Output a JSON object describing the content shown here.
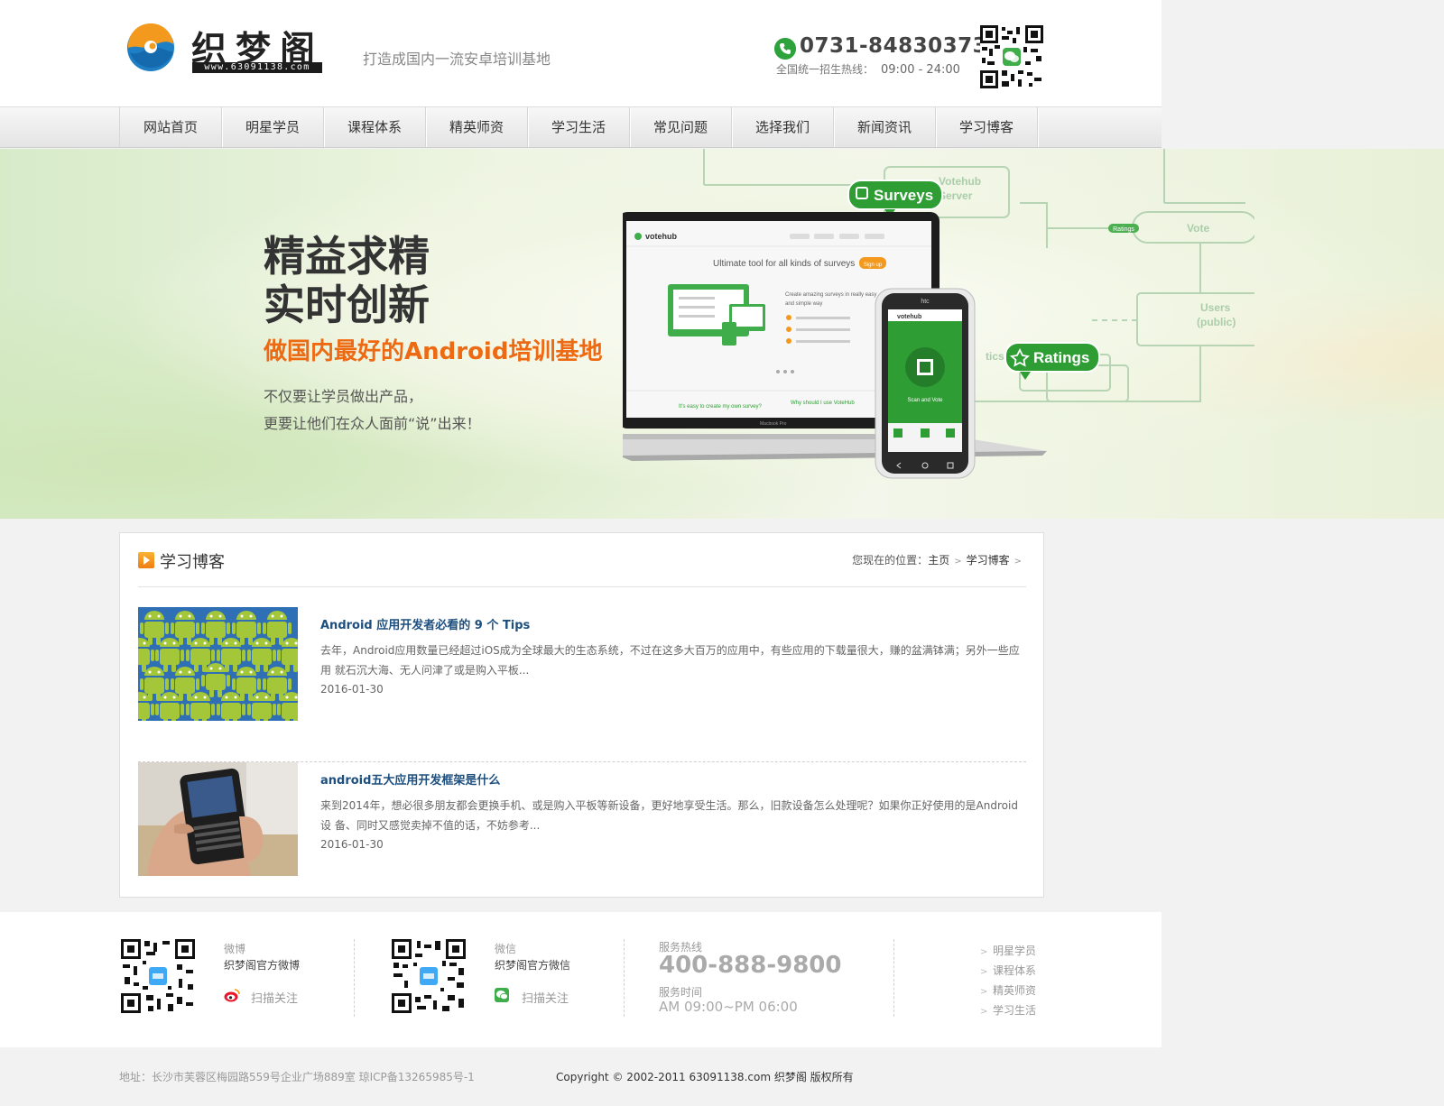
{
  "header": {
    "logo_name": "织梦阁",
    "logo_url": "www.63091138.com",
    "slogan": "打造成国内一流安卓培训基地",
    "phone": "0731-84830373",
    "hotline_label": "全国统一招生热线：",
    "hotline_hours": "09:00 - 24:00"
  },
  "nav": {
    "items": [
      "网站首页",
      "明星学员",
      "课程体系",
      "精英师资",
      "学习生活",
      "常见问题",
      "选择我们",
      "新闻资讯",
      "学习博客"
    ]
  },
  "banner": {
    "headline_1": "精益求精",
    "headline_2": "实时创新",
    "subheadline": "做国内最好的Android培训基地",
    "text_1": "不仅要让学员做出产品，",
    "text_2": "更要让他们在众人面前“说”出来！",
    "art": {
      "surveys_label": "Surveys",
      "ratings_label": "Ratings",
      "ratings_small": "Ratings",
      "vote_label": "Vote",
      "users_label": "Users",
      "users_sub": "(public)",
      "server_label": "Votehub",
      "server_sub": "Server",
      "stats_label": "tics",
      "laptop_brand": "votehub",
      "laptop_tagline": "Ultimate tool for all kinds of surveys",
      "laptop_signup": "Sign up",
      "laptop_desc_1": "Create amazing surveys in really easy",
      "laptop_desc_2": "and simple way",
      "laptop_bottom_1": "It's easy to create my own survey?",
      "laptop_bottom_2": "Why should I use VoteHub",
      "laptop_model": "Macbook Pro",
      "phone_brand": "htc",
      "phone_app": "votehub",
      "phone_scan": "Scan and Vote"
    },
    "colors": {
      "accent_orange": "#ee6a12",
      "brand_green": "#2fa33b"
    }
  },
  "section": {
    "title": "学习博客",
    "breadcrumb_prefix": "您现在的位置：",
    "breadcrumb_home": "主页",
    "breadcrumb_current": "学习博客"
  },
  "posts": [
    {
      "title": "Android 应用开发者必看的 9 个 Tips",
      "excerpt": "去年，Android应用数量已经超过iOS成为全球最大的生态系统，不过在这多大百万的应用中，有些应用的下载量很大，赚的盆满钵满；另外一些应用 就石沉大海、无人问津了或是购入平板...",
      "date": "2016-01-30"
    },
    {
      "title": "android五大应用开发框架是什么",
      "excerpt": "来到2014年，想必很多朋友都会更换手机、或是购入平板等新设备，更好地享受生活。那么，旧款设备怎么处理呢？如果你正好使用的是Android设 备、同时又感觉卖掉不值的话，不妨参考...",
      "date": "2016-01-30"
    }
  ],
  "footer": {
    "weibo": {
      "label": "微博",
      "name": "织梦阁官方微博",
      "follow": "扫描关注"
    },
    "wechat": {
      "label": "微信",
      "name": "织梦阁官方微信",
      "follow": "扫描关注"
    },
    "service": {
      "hotline_label": "服务热线",
      "hotline": "400-888-9800",
      "time_label": "服务时间",
      "time": "AM 09:00~PM 06:00"
    },
    "links": [
      "明星学员",
      "课程体系",
      "精英师资",
      "学习生活"
    ],
    "address": "地址：长沙市芙蓉区梅园路559号企业广场889室 琼ICP备13265985号-1",
    "copyright": "Copyright © 2002-2011 63091138.com 织梦阁 版权所有"
  }
}
